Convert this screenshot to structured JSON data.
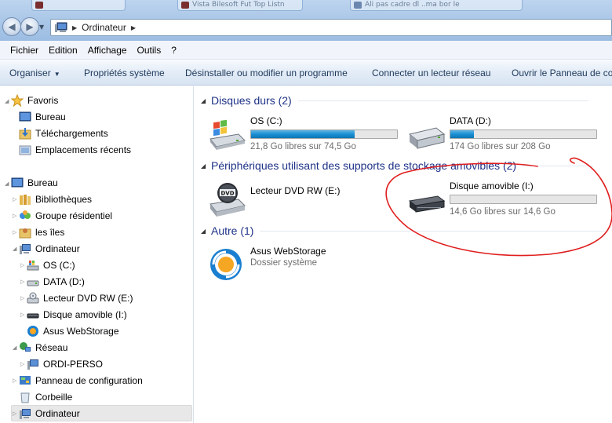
{
  "window": {
    "background_tabs": [
      "",
      "Vista Bilesoft Fut",
      "Top Listn",
      "",
      "Ali pas cadre dl ..ma bor le"
    ]
  },
  "address": {
    "path": [
      "Ordinateur"
    ]
  },
  "menubar": {
    "items": [
      "Fichier",
      "Edition",
      "Affichage",
      "Outils",
      "?"
    ]
  },
  "commandbar": {
    "organiser": "Organiser",
    "items": [
      "Propriétés système",
      "Désinstaller ou modifier un programme",
      "Connecter un lecteur réseau",
      "Ouvrir le Panneau de co"
    ]
  },
  "navpane": {
    "favorites": {
      "label": "Favoris",
      "items": [
        "Bureau",
        "Téléchargements",
        "Emplacements récents"
      ]
    },
    "desktop": {
      "label": "Bureau",
      "items": [
        "Bibliothèques",
        "Groupe résidentiel",
        "les îles"
      ]
    },
    "computer": {
      "label": "Ordinateur",
      "items": [
        "OS (C:)",
        "DATA (D:)",
        "Lecteur DVD RW (E:)",
        "Disque amovible (I:)",
        "Asus WebStorage"
      ]
    },
    "network": {
      "label": "Réseau",
      "items": [
        "ORDI-PERSO"
      ]
    },
    "control_panel": "Panneau de configuration",
    "recycle_bin": "Corbeille",
    "computer_bottom": "Ordinateur"
  },
  "content": {
    "hard_drives": {
      "header": "Disques durs (2)",
      "drives": [
        {
          "name": "OS (C:)",
          "free_text": "21,8 Go libres sur 74,5 Go",
          "used_fraction": 0.71
        },
        {
          "name": "DATA (D:)",
          "free_text": "174 Go libres sur 208 Go",
          "used_fraction": 0.16
        }
      ]
    },
    "removable": {
      "header": "Périphériques utilisant des supports de stockage amovibles (2)",
      "devices": [
        {
          "name": "Lecteur DVD RW (E:)"
        },
        {
          "name": "Disque amovible (I:)",
          "free_text": "14,6 Go libres sur 14,6 Go",
          "used_fraction": 0.0
        }
      ]
    },
    "other": {
      "header": "Autre (1)",
      "items": [
        {
          "name": "Asus WebStorage",
          "subtitle": "Dossier système"
        }
      ]
    }
  },
  "colors": {
    "annotation_red": "#e01e1e",
    "bar_fill": "#1a8fd2",
    "group_header": "#1e3287"
  }
}
